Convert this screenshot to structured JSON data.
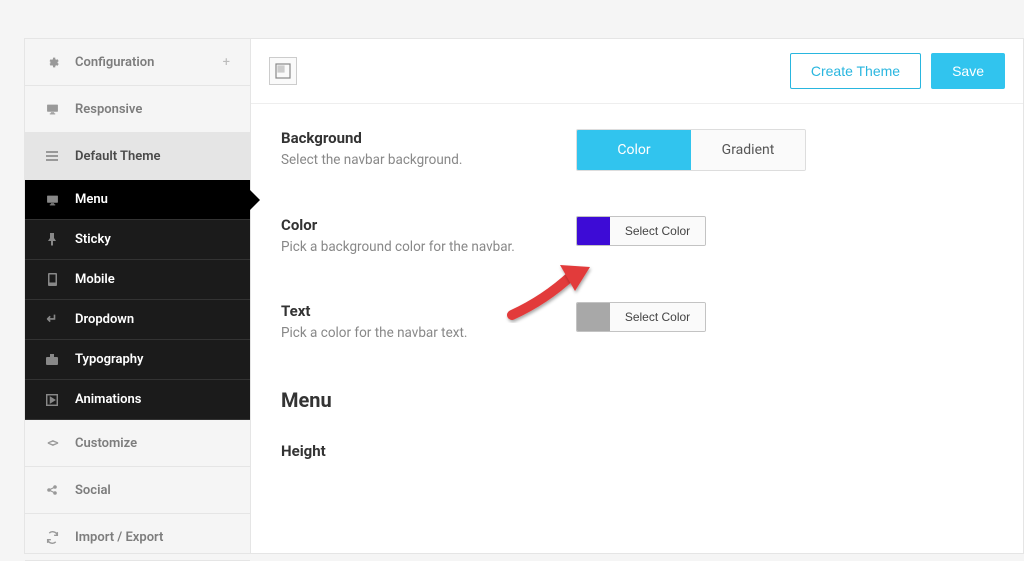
{
  "sidebar": {
    "items": [
      {
        "label": "Configuration",
        "icon": "gear",
        "plus": true
      },
      {
        "label": "Responsive",
        "icon": "monitor"
      },
      {
        "label": "Default Theme",
        "icon": "menu",
        "expanded": true
      },
      {
        "label": "Menu",
        "icon": "monitor",
        "sub": true,
        "active": true
      },
      {
        "label": "Sticky",
        "icon": "pin",
        "sub": true
      },
      {
        "label": "Mobile",
        "icon": "phone",
        "sub": true
      },
      {
        "label": "Dropdown",
        "icon": "return",
        "sub": true
      },
      {
        "label": "Typography",
        "icon": "case",
        "sub": true
      },
      {
        "label": "Animations",
        "icon": "play",
        "sub": true
      },
      {
        "label": "Customize",
        "icon": "code"
      },
      {
        "label": "Social",
        "icon": "share"
      },
      {
        "label": "Import / Export",
        "icon": "refresh"
      }
    ]
  },
  "topbar": {
    "create_theme": "Create Theme",
    "save": "Save"
  },
  "fields": {
    "background": {
      "title": "Background",
      "desc": "Select the navbar background.",
      "options": [
        "Color",
        "Gradient"
      ],
      "active": 0
    },
    "color": {
      "title": "Color",
      "desc": "Pick a background color for the navbar.",
      "button": "Select Color",
      "swatch": "#3d0bd6"
    },
    "text": {
      "title": "Text",
      "desc": "Pick a color for the navbar text.",
      "button": "Select Color",
      "swatch": "#a8a8a8"
    }
  },
  "section_heading": "Menu",
  "next_field_title": "Height"
}
